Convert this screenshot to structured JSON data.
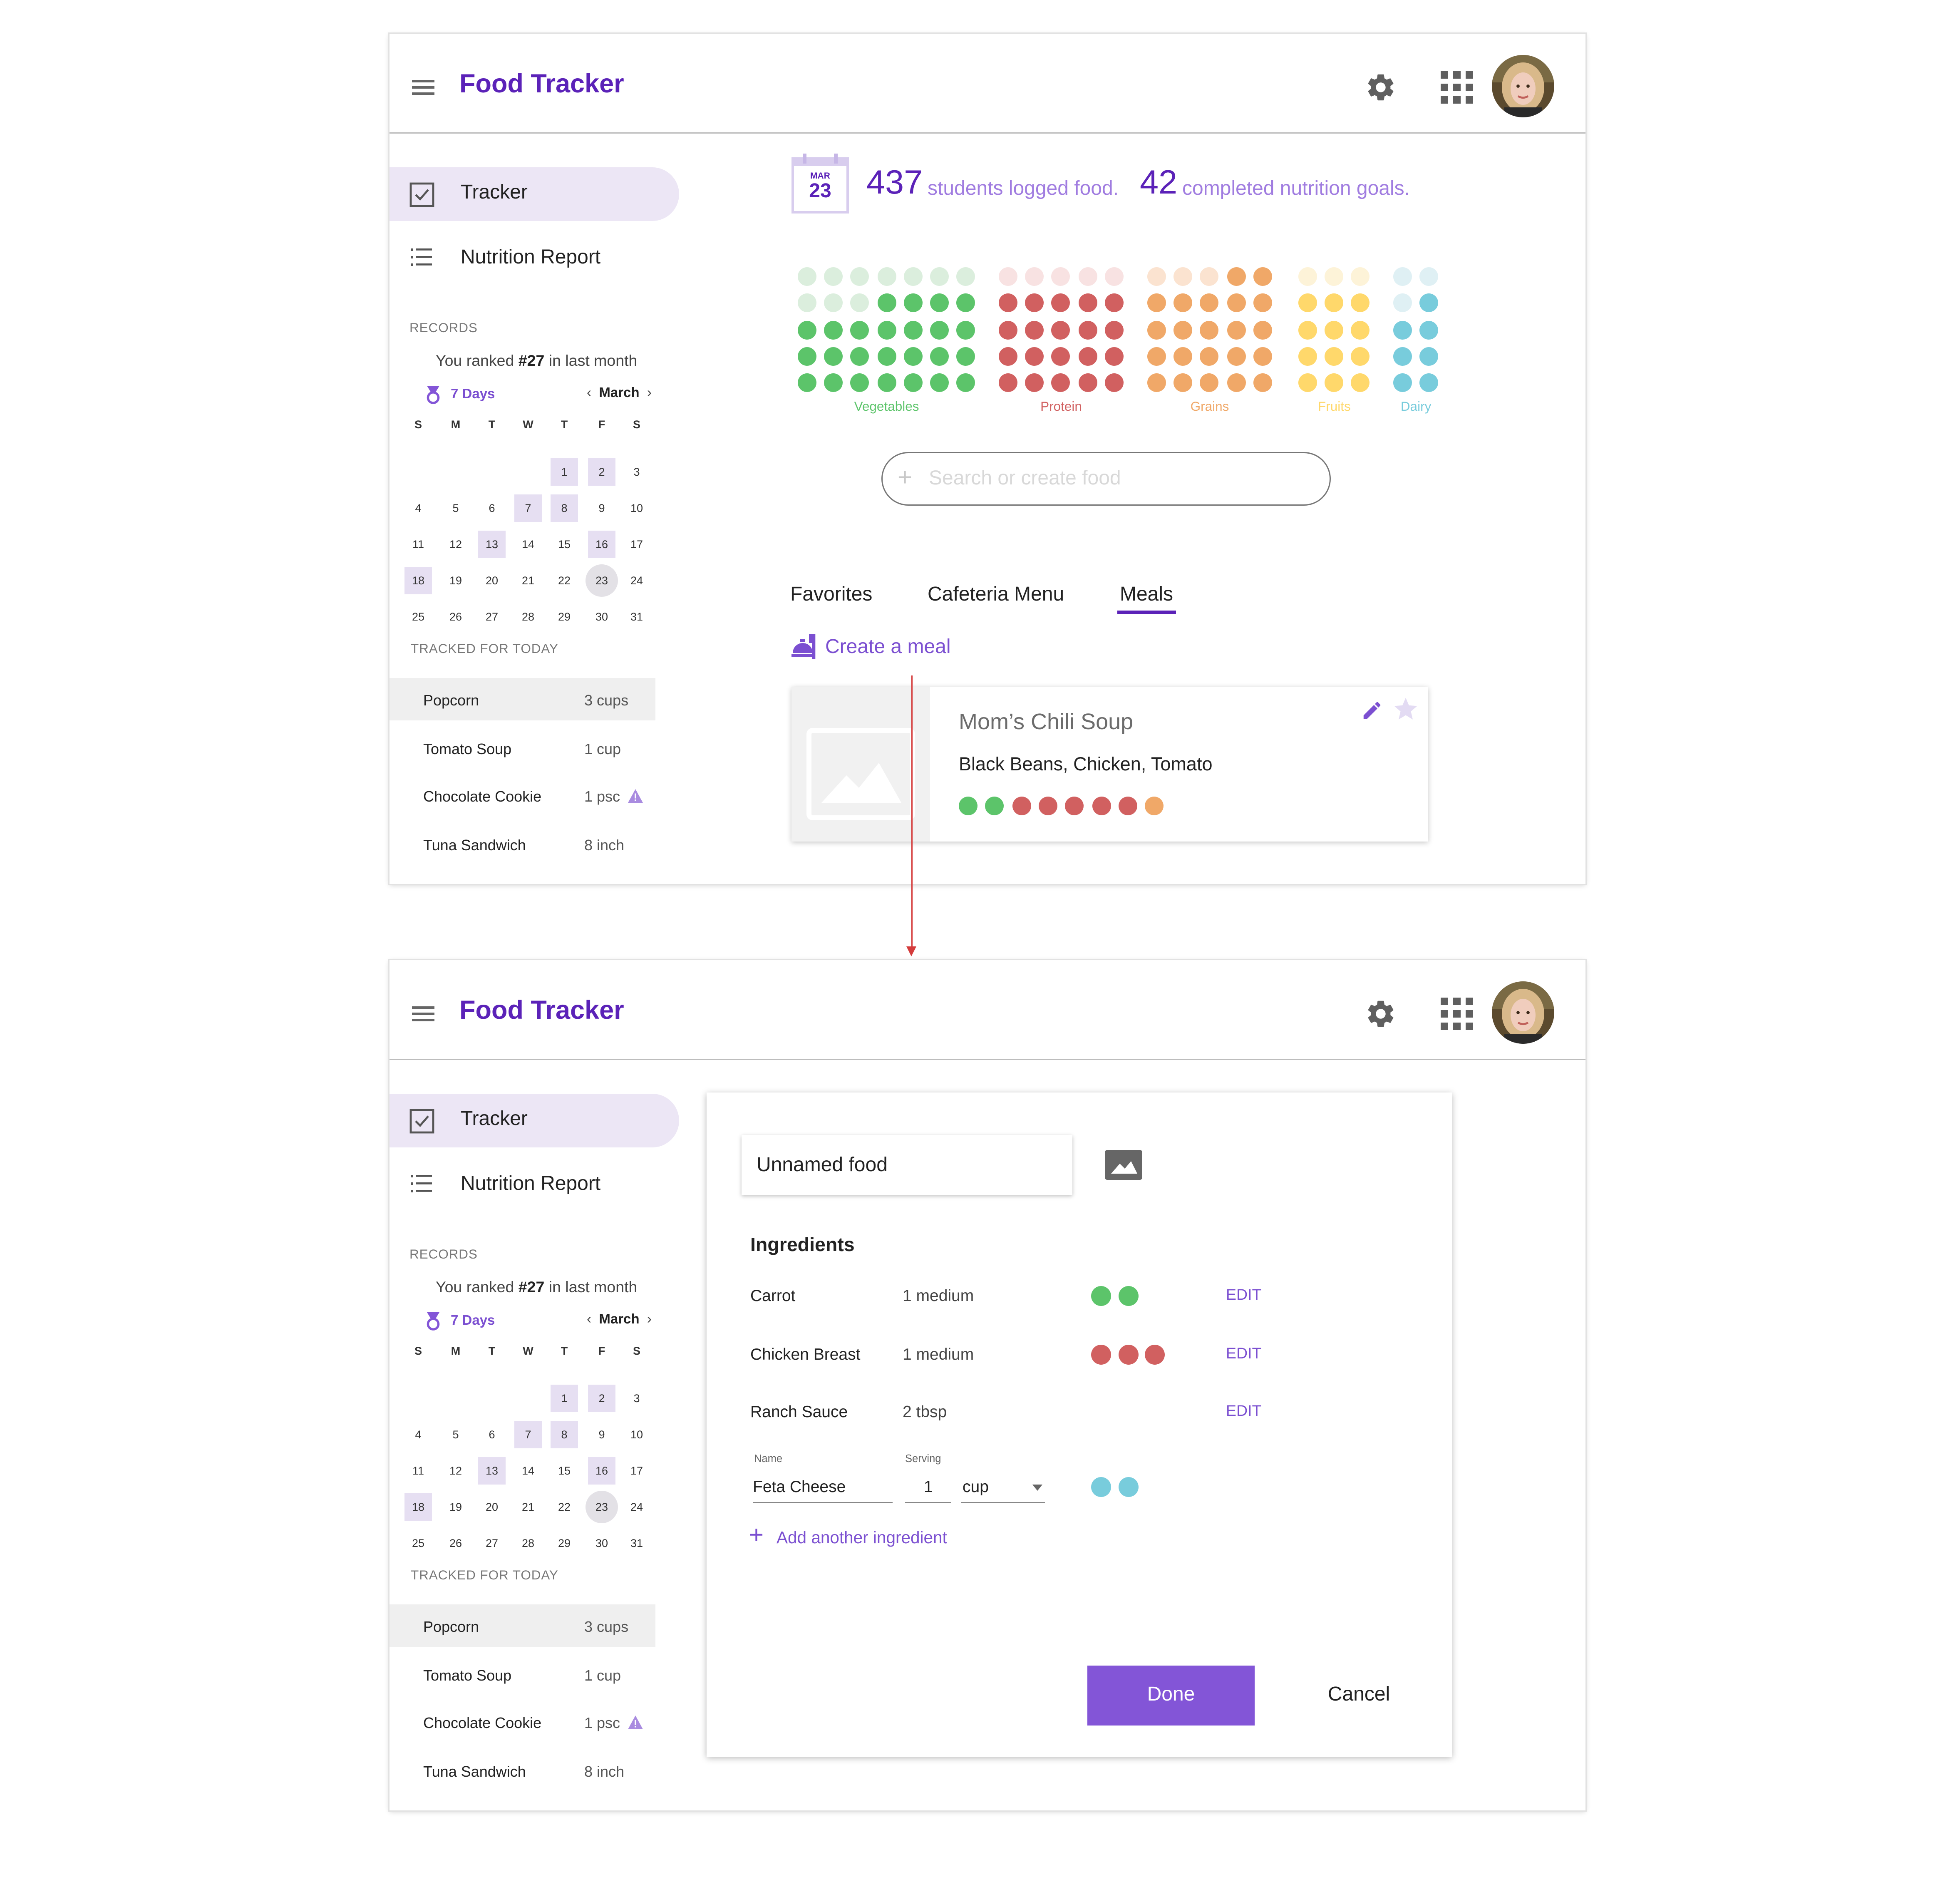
{
  "app": {
    "title": "Food Tracker"
  },
  "sidebar": {
    "nav": [
      {
        "label": "Tracker"
      },
      {
        "label": "Nutrition Report"
      }
    ],
    "records_title": "RECORDS",
    "rank_prefix": "You ranked ",
    "rank_value": "#27",
    "rank_suffix": " in last month",
    "streak": "7 Days",
    "month": "March",
    "weekdays": [
      "S",
      "M",
      "T",
      "W",
      "T",
      "F",
      "S"
    ],
    "calendar_days": [
      [
        null,
        null,
        null,
        null,
        "1",
        "2",
        "3"
      ],
      [
        "4",
        "5",
        "6",
        "7",
        "8",
        "9",
        "10"
      ],
      [
        "11",
        "12",
        "13",
        "14",
        "15",
        "16",
        "17"
      ],
      [
        "18",
        "19",
        "20",
        "21",
        "22",
        "23",
        "24"
      ],
      [
        "25",
        "26",
        "27",
        "28",
        "29",
        "30",
        "31"
      ]
    ],
    "highlighted_days": [
      "1",
      "2",
      "7",
      "8",
      "13",
      "16",
      "18"
    ],
    "today": "23",
    "tracked_title": "TRACKED FOR TODAY",
    "tracked": [
      {
        "name": "Popcorn",
        "qty": "3 cups",
        "warning": false
      },
      {
        "name": "Tomato Soup",
        "qty": "1 cup",
        "warning": false
      },
      {
        "name": "Chocolate Cookie",
        "qty": "1 psc",
        "warning": true
      },
      {
        "name": "Tuna Sandwich",
        "qty": "8 inch",
        "warning": false
      }
    ]
  },
  "stats": {
    "date_month": "MAR",
    "date_day": "23",
    "logged_num": "437",
    "logged_text": "students logged food.",
    "goals_num": "42",
    "goals_text": "completed nutrition goals."
  },
  "food_groups": [
    {
      "label": "Vegetables",
      "color": "#5cc46a",
      "faded": "#dbeedd",
      "cols": 7,
      "filled": 25
    },
    {
      "label": "Protein",
      "color": "#d16060",
      "faded": "#f8e2e2",
      "cols": 5,
      "filled": 20
    },
    {
      "label": "Grains",
      "color": "#f0a868",
      "faded": "#fbe3d0",
      "cols": 5,
      "filled": 22
    },
    {
      "label": "Fruits",
      "color": "#ffd86b",
      "faded": "#fdf3d8",
      "cols": 3,
      "filled": 12
    },
    {
      "label": "Dairy",
      "color": "#78ccdc",
      "faded": "#dff0f4",
      "cols": 2,
      "filled": 7
    }
  ],
  "search": {
    "placeholder": "Search or create food"
  },
  "tabs": [
    {
      "label": "Favorites"
    },
    {
      "label": "Cafeteria Menu"
    },
    {
      "label": "Meals"
    }
  ],
  "active_tab": "Meals",
  "create_meal": {
    "label": "Create a meal"
  },
  "meal_card": {
    "name": "Mom’s Chili Soup",
    "ingredients": "Black Beans, Chicken, Tomato",
    "dots": [
      "#5cc46a",
      "#5cc46a",
      "#d16060",
      "#d16060",
      "#d16060",
      "#d16060",
      "#d16060",
      "#f0a868"
    ]
  },
  "dialog": {
    "food_name": "Unnamed food",
    "ingredients_title": "Ingredients",
    "edit_label": "EDIT",
    "ingredients": [
      {
        "name": "Carrot",
        "serving": "1 medium",
        "dots": [
          "#5cc46a",
          "#5cc46a"
        ]
      },
      {
        "name": "Chicken Breast",
        "serving": "1 medium",
        "dots": [
          "#d16060",
          "#d16060",
          "#d16060"
        ]
      },
      {
        "name": "Ranch Sauce",
        "serving": "2 tbsp",
        "dots": []
      }
    ],
    "new_ingredient": {
      "name_label": "Name",
      "serving_label": "Serving",
      "name_value": "Feta Cheese",
      "amount_value": "1",
      "unit_value": "cup",
      "dots": [
        "#78ccdc",
        "#78ccdc"
      ]
    },
    "add_label": "Add another ingredient",
    "done_label": "Done",
    "cancel_label": "Cancel"
  },
  "colors": {
    "accent": "#5b22b8",
    "accent_light": "#8355d7",
    "flow_arrow": "#d43b3b"
  }
}
